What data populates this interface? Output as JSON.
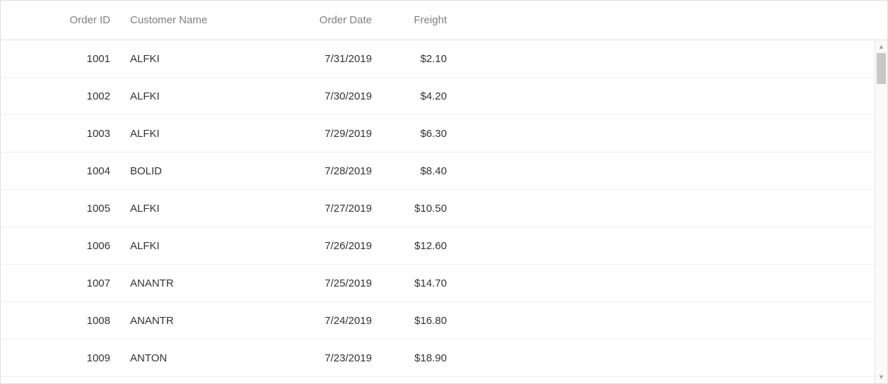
{
  "table": {
    "columns": [
      {
        "key": "order_id",
        "label": "Order ID",
        "align": "right"
      },
      {
        "key": "customer_name",
        "label": "Customer Name",
        "align": "left"
      },
      {
        "key": "order_date",
        "label": "Order Date",
        "align": "right"
      },
      {
        "key": "freight",
        "label": "Freight",
        "align": "right"
      }
    ],
    "rows": [
      {
        "order_id": "1001",
        "customer_name": "ALFKI",
        "order_date": "7/31/2019",
        "freight": "$2.10"
      },
      {
        "order_id": "1002",
        "customer_name": "ALFKI",
        "order_date": "7/30/2019",
        "freight": "$4.20"
      },
      {
        "order_id": "1003",
        "customer_name": "ALFKI",
        "order_date": "7/29/2019",
        "freight": "$6.30"
      },
      {
        "order_id": "1004",
        "customer_name": "BOLID",
        "order_date": "7/28/2019",
        "freight": "$8.40"
      },
      {
        "order_id": "1005",
        "customer_name": "ALFKI",
        "order_date": "7/27/2019",
        "freight": "$10.50"
      },
      {
        "order_id": "1006",
        "customer_name": "ALFKI",
        "order_date": "7/26/2019",
        "freight": "$12.60"
      },
      {
        "order_id": "1007",
        "customer_name": "ANANTR",
        "order_date": "7/25/2019",
        "freight": "$14.70"
      },
      {
        "order_id": "1008",
        "customer_name": "ANANTR",
        "order_date": "7/24/2019",
        "freight": "$16.80"
      },
      {
        "order_id": "1009",
        "customer_name": "ANTON",
        "order_date": "7/23/2019",
        "freight": "$18.90"
      }
    ]
  }
}
